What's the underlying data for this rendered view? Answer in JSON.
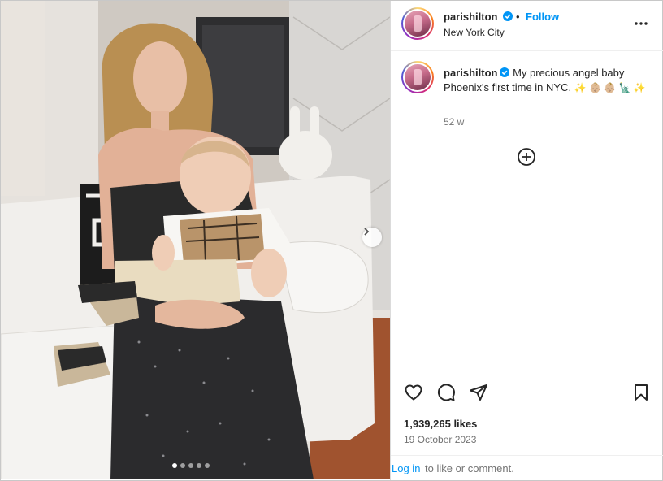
{
  "post": {
    "photo_alt": "Woman holding a baby on a white couch",
    "carousel": {
      "count": 5,
      "active_index": 0
    }
  },
  "header": {
    "username": "parishilton",
    "separator": "•",
    "follow_label": "Follow",
    "location": "New York City"
  },
  "caption": {
    "username": "parishilton",
    "text": "My precious angel baby Phoenix's first time in NYC.",
    "emojis": "✨ 👶🏼 👶🏼 🗽 ✨",
    "age": "52 w"
  },
  "stats": {
    "likes": "1,939,265 likes",
    "date": "19 October 2023"
  },
  "login": {
    "link": "Log in",
    "rest": "to like or comment."
  },
  "colors": {
    "accent": "#0095f6",
    "text": "#262626",
    "muted": "#737373"
  },
  "icons": [
    "verified-badge-icon",
    "more-options-icon",
    "add-comment-icon",
    "heart-icon",
    "comment-icon",
    "share-icon",
    "bookmark-icon",
    "chevron-right-icon"
  ]
}
